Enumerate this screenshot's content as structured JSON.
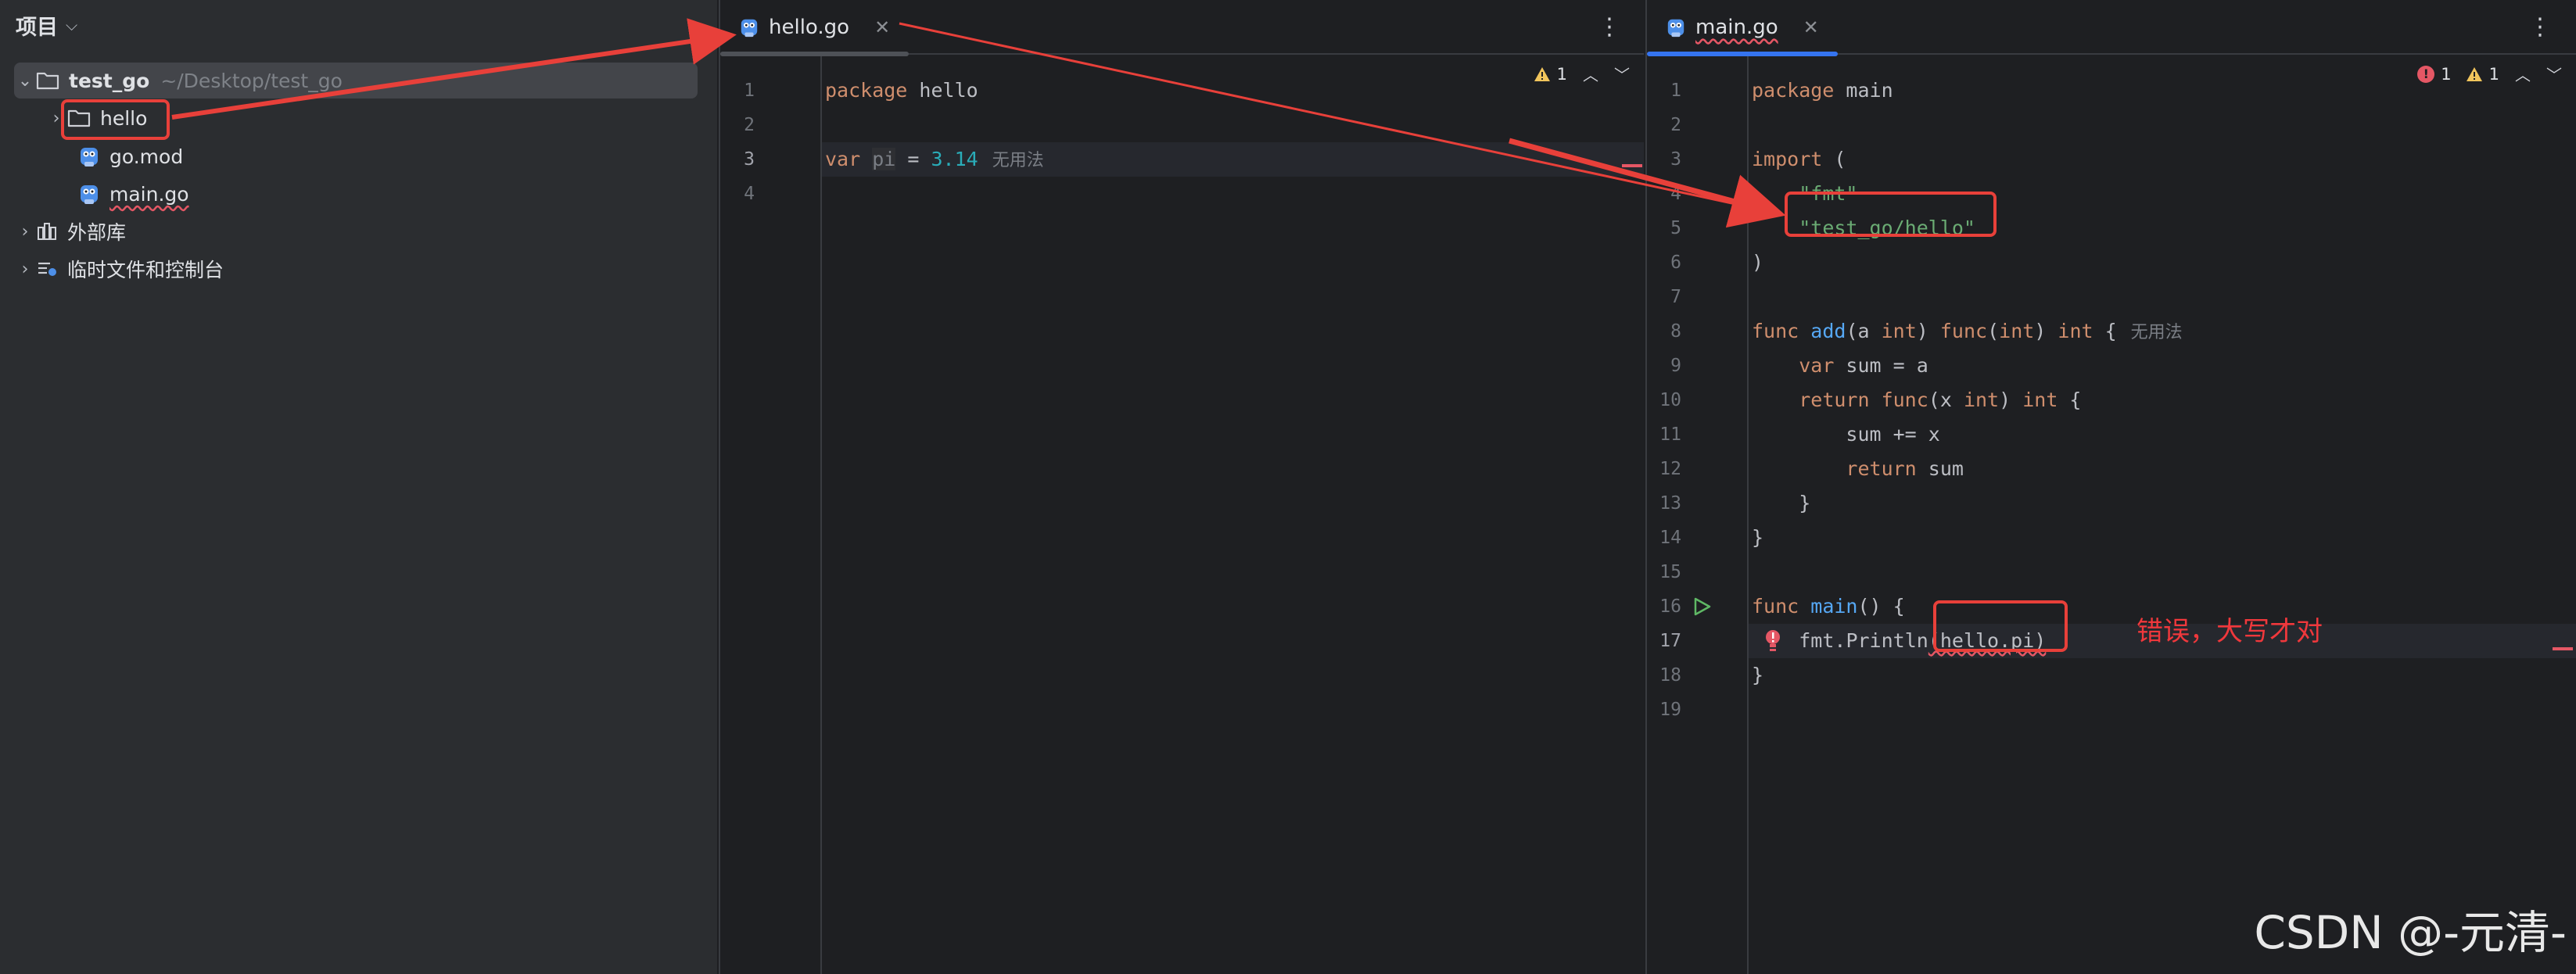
{
  "project_panel": {
    "title": "项目",
    "root": {
      "name": "test_go",
      "path": "~/Desktop/test_go"
    },
    "items": [
      {
        "label": "hello",
        "kind": "folder"
      },
      {
        "label": "go.mod",
        "kind": "go-file"
      },
      {
        "label": "main.go",
        "kind": "go-file"
      }
    ],
    "external_libs": "外部库",
    "scratches": "临时文件和控制台"
  },
  "left_editor": {
    "tab_label": "hello.go",
    "warning_count": "1",
    "line_numbers": [
      "1",
      "2",
      "3",
      "4"
    ],
    "code": {
      "l1_kw": "package",
      "l1_name": " hello",
      "l3_kw": "var",
      "l3_var": "pi",
      "l3_eq": " = ",
      "l3_num": "3.14",
      "l3_hint": "无用法"
    }
  },
  "right_editor": {
    "tab_label": "main.go",
    "error_count": "1",
    "warning_count": "1",
    "line_numbers": [
      "1",
      "2",
      "3",
      "4",
      "5",
      "6",
      "7",
      "8",
      "9",
      "10",
      "11",
      "12",
      "13",
      "14",
      "15",
      "16",
      "17",
      "18",
      "19"
    ],
    "code": {
      "l1_kw": "package",
      "l1_name": " main",
      "l3_kw": "import",
      "l3_rest": " (",
      "l4_str": "\"fmt\"",
      "l5_str": "\"test_go/hello\"",
      "l6": ")",
      "l8_kw": "func",
      "l8_fn": "add",
      "l8_p1": "(a ",
      "l8_t1": "int",
      "l8_p2": ") ",
      "l8_kw2": "func",
      "l8_p3": "(",
      "l8_t2": "int",
      "l8_p4": ") ",
      "l8_t3": "int",
      "l8_p5": " {",
      "l8_hint": "无用法",
      "l9_kw": "var",
      "l9_rest": " sum = a",
      "l10_kw": "return",
      "l10_kw2": " func",
      "l10_p1": "(x ",
      "l10_t1": "int",
      "l10_p2": ") ",
      "l10_t2": "int",
      "l10_p3": " {",
      "l11": "sum += x",
      "l12_kw": "return",
      "l12_rest": " sum",
      "l13": "}",
      "l14": "}",
      "l16_kw": "func",
      "l16_fn": "main",
      "l16_rest": "() {",
      "l17_pkg": "fmt",
      "l17_dot": ".",
      "l17_call": "Println",
      "l17_args": "(hello.pi)",
      "l18": "}"
    }
  },
  "annotation": "错误，大写才对",
  "watermark": "CSDN @-元清-",
  "colors": {
    "keyword": "#cf8e6d",
    "string": "#6aab73",
    "number": "#2aacb8",
    "function": "#56a8f5",
    "annotation_red": "#e8403a",
    "tab_active_left": "#4e5157",
    "tab_active_right": "#3574f0"
  }
}
